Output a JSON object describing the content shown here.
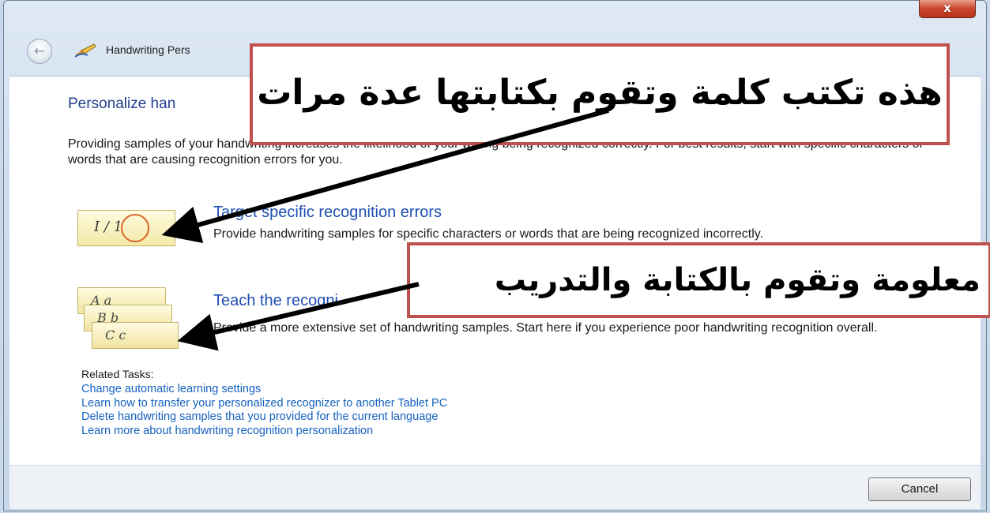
{
  "window": {
    "title": "Handwriting Pers",
    "close_label": "x",
    "back_label": "←"
  },
  "page": {
    "heading": "Personalize han",
    "intro": "Providing samples of your handwriting increases the likelihood of your writing being recognized correctly. For best results, start with specific characters or words that are causing recognition errors for you."
  },
  "options": [
    {
      "title": "Target specific recognition errors",
      "description": "Provide handwriting samples for specific characters or words that are being recognized incorrectly."
    },
    {
      "title": "Teach the recogni",
      "description": "Provide a more extensive set of handwriting samples. Start here if you experience poor handwriting recognition overall."
    }
  ],
  "related": {
    "label": "Related Tasks:",
    "links": [
      "Change automatic learning settings",
      "Learn how to transfer your personalized recognizer to another Tablet PC",
      "Delete handwriting samples that you provided for the current language",
      "Learn more about handwriting recognition personalization"
    ]
  },
  "footer": {
    "cancel_label": "Cancel"
  },
  "callouts": {
    "first": "هذه تكتب كلمة وتقوم بكتابتها عدة مرات",
    "second": "ت معلومة وتقوم بالكتابة والتدريب"
  },
  "icons": {
    "target_glyphs": "I  /  1",
    "teach_cards": [
      "A  a",
      "B  b",
      "C  c"
    ]
  },
  "colors": {
    "heading": "#1e3f8c",
    "link": "#1561c0",
    "callout_border": "#c0504d",
    "close": "#c9462b"
  }
}
